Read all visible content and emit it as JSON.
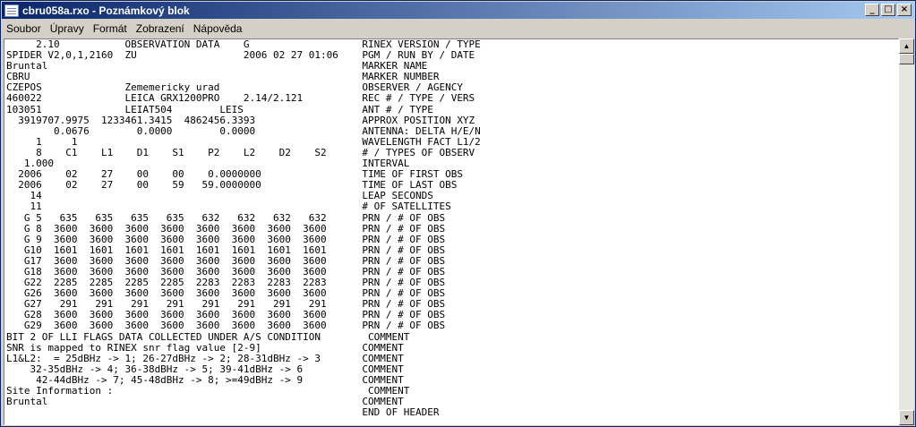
{
  "window": {
    "title": "cbru058a.rxo - Poznámkový blok",
    "minimize_glyph": "_",
    "maximize_glyph": "□",
    "close_glyph": "×"
  },
  "menu": {
    "items": [
      "Soubor",
      "Úpravy",
      "Formát",
      "Zobrazení",
      "Nápověda"
    ]
  },
  "editor": {
    "lines": [
      "     2.10           OBSERVATION DATA    G                   RINEX VERSION / TYPE",
      "SPIDER V2,0,1,2160  ZU                  2006 02 27 01:06    PGM / RUN BY / DATE",
      "Bruntal                                                     MARKER NAME",
      "CBRU                                                        MARKER NUMBER",
      "CZEPOS              Zememericky urad                        OBSERVER / AGENCY",
      "460022              LEICA GRX1200PRO    2.14/2.121          REC # / TYPE / VERS",
      "103051              LEIAT504        LEIS                    ANT # / TYPE",
      "  3919707.9975  1233461.3415  4862456.3393                  APPROX POSITION XYZ",
      "        0.0676        0.0000        0.0000                  ANTENNA: DELTA H/E/N",
      "     1     1                                                WAVELENGTH FACT L1/2",
      "     8    C1    L1    D1    S1    P2    L2    D2    S2      # / TYPES OF OBSERV",
      "   1.000                                                    INTERVAL",
      "  2006    02    27    00    00    0.0000000                 TIME OF FIRST OBS",
      "  2006    02    27    00    59   59.0000000                 TIME OF LAST OBS",
      "    14                                                      LEAP SECONDS",
      "    11                                                      # OF SATELLITES",
      "   G 5   635   635   635   635   632   632   632   632      PRN / # OF OBS",
      "   G 8  3600  3600  3600  3600  3600  3600  3600  3600      PRN / # OF OBS",
      "   G 9  3600  3600  3600  3600  3600  3600  3600  3600      PRN / # OF OBS",
      "   G10  1601  1601  1601  1601  1601  1601  1601  1601      PRN / # OF OBS",
      "   G17  3600  3600  3600  3600  3600  3600  3600  3600      PRN / # OF OBS",
      "   G18  3600  3600  3600  3600  3600  3600  3600  3600      PRN / # OF OBS",
      "   G22  2285  2285  2285  2285  2283  2283  2283  2283      PRN / # OF OBS",
      "   G26  3600  3600  3600  3600  3600  3600  3600  3600      PRN / # OF OBS",
      "   G27   291   291   291   291   291   291   291   291      PRN / # OF OBS",
      "   G28  3600  3600  3600  3600  3600  3600  3600  3600      PRN / # OF OBS",
      "   G29  3600  3600  3600  3600  3600  3600  3600  3600      PRN / # OF OBS",
      "BIT 2 OF LLI FLAGS DATA COLLECTED UNDER A/S CONDITION        COMMENT",
      "SNR is mapped to RINEX snr flag value [2-9]                 COMMENT",
      "L1&L2:  = 25dBHz -> 1; 26-27dBHz -> 2; 28-31dBHz -> 3       COMMENT",
      "    32-35dBHz -> 4; 36-38dBHz -> 5; 39-41dBHz -> 6          COMMENT",
      "     42-44dBHz -> 7; 45-48dBHz -> 8; >=49dBHz -> 9          COMMENT",
      "Site Information :                                           COMMENT",
      "Bruntal                                                     COMMENT",
      "                                                            END OF HEADER"
    ]
  },
  "scrollbar": {
    "up_glyph": "▲",
    "down_glyph": "▼"
  }
}
